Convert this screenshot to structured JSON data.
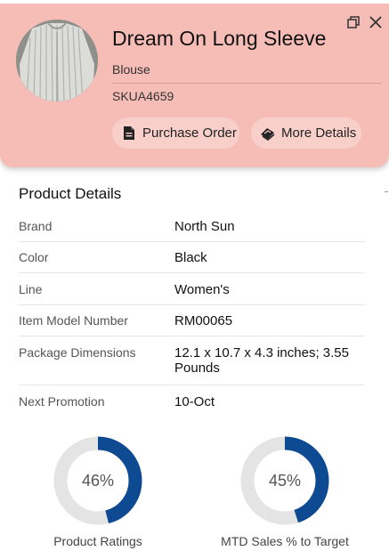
{
  "product": {
    "title": "Dream On Long Sleeve",
    "category": "Blouse",
    "sku": "SKUA4659",
    "image_icon": "blouse-photo"
  },
  "actions": {
    "purchase_order_label": "Purchase Order",
    "purchase_order_icon": "document-icon",
    "more_details_label": "More Details",
    "more_details_icon": "books-icon"
  },
  "window": {
    "restore_icon": "restore-icon",
    "close_icon": "close-icon"
  },
  "details": {
    "section_title": "Product Details",
    "rows": [
      {
        "label": "Brand",
        "value": "North Sun"
      },
      {
        "label": "Color",
        "value": "Black"
      },
      {
        "label": "Line",
        "value": "Women's"
      },
      {
        "label": "Item Model Number",
        "value": "RM00065"
      },
      {
        "label": "Package Dimensions",
        "value": "12.1 x 10.7 x 4.3 inches; 3.55 Pounds"
      },
      {
        "label": "Next Promotion",
        "value": "10-Oct"
      }
    ]
  },
  "metrics": [
    {
      "label": "Product Ratings",
      "percent_text": "46%",
      "value": 0.46
    },
    {
      "label": "MTD Sales % to Target",
      "percent_text": "45%",
      "value": 0.45
    }
  ],
  "colors": {
    "header_bg": "#f6bdb7",
    "pill_bg": "#f9cfca",
    "gauge_fill": "#0d4a92",
    "gauge_track": "#e4e4e4"
  }
}
